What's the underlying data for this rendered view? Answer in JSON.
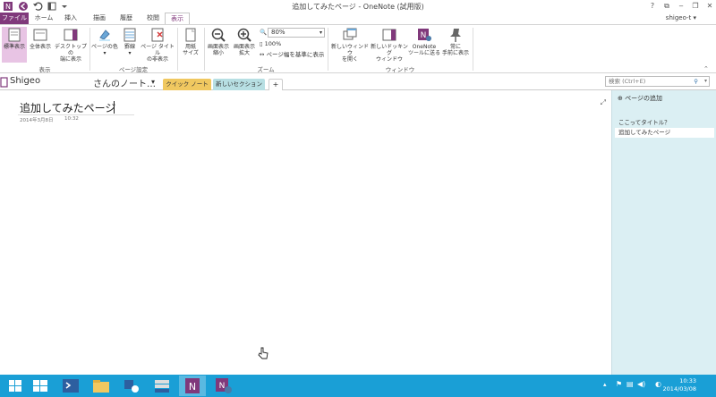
{
  "window": {
    "title": "追加してみたページ - OneNote (試用版)",
    "help": "?",
    "restore": "⧉",
    "minimize": "‒",
    "maximize": "❐",
    "close": "✕"
  },
  "tabs": [
    "ファイル",
    "ホーム",
    "挿入",
    "描画",
    "履歴",
    "校閲",
    "表示"
  ],
  "user": "shigeo-t ▾",
  "ribbon": {
    "view": {
      "normal": "標準表示",
      "full": "全体表示",
      "dock1": "デスクトップの",
      "dock2": "端に表示",
      "label": "表示"
    },
    "page_setup": {
      "color": "ページの色",
      "color_dd": "▾",
      "rules": "罫線",
      "rules_dd": "▾",
      "hide1": "ページ タイトル",
      "hide2": "の非表示",
      "label": "ページ設定"
    },
    "paper": {
      "l1": "用紙",
      "l2": "サイズ"
    },
    "zoom": {
      "out1": "画面表示",
      "out2": "縮小",
      "in1": "画面表示",
      "in2": "拡大",
      "value": "80%",
      "hundred": "100%",
      "fit": "ページ幅を基準に表示",
      "label": "ズーム"
    },
    "window": {
      "nw1": "新しいウィンドウ",
      "nw2": "を開く",
      "dock1": "新しいドッキング",
      "dock2": "ウィンドウ",
      "tool1": "OneNote",
      "tool2": "ツールに送る",
      "top1": "常に",
      "top2": "手前に表示",
      "label": "ウィンドウ"
    }
  },
  "notebook": {
    "name": "Shigeo",
    "title": "さんのノート…",
    "title_dd": "▾"
  },
  "sections": [
    {
      "label": "クイック ノート",
      "color": "#f0c860"
    },
    {
      "label": "新しいセクション 1",
      "color": "#b7dfe3"
    },
    {
      "label": "+",
      "color": "#ffffff"
    }
  ],
  "search": {
    "placeholder": "検索 (Ctrl+E)"
  },
  "page": {
    "title": "追加してみたページ",
    "date": "2014年3月8日",
    "time": "10:32"
  },
  "pane": {
    "add": "ページの追加",
    "hint": "ここってタイトル？",
    "item": "追加してみたページ"
  },
  "taskbar": {
    "time": "10:33",
    "date": "2014/03/08"
  }
}
